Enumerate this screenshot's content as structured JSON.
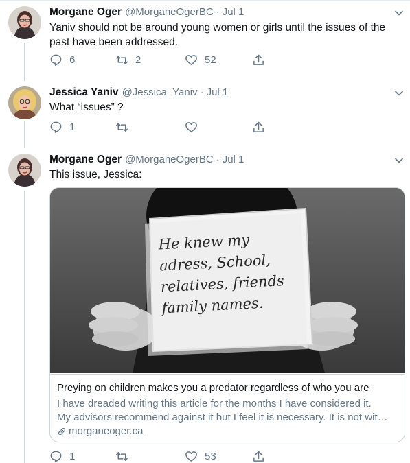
{
  "tweets": [
    {
      "name": "Morgane Oger",
      "handle": "@MorganeOgerBC",
      "separator": "·",
      "date": "Jul 1",
      "text_lines": [
        "Yaniv should not be around young women or girls until the issues of the",
        "past have been addressed."
      ],
      "reply_count": "6",
      "retweet_count": "2",
      "like_count": "52"
    },
    {
      "name": "Jessica Yaniv",
      "handle": "@Jessica_Yaniv",
      "separator": "·",
      "date": "Jul 1",
      "text_lines": [
        "What “issues” ?"
      ],
      "reply_count": "1",
      "retweet_count": "",
      "like_count": ""
    },
    {
      "name": "Morgane Oger",
      "handle": "@MorganeOgerBC",
      "separator": "·",
      "date": "Jul 1",
      "text_lines": [
        "This issue, Jessica:"
      ],
      "reply_count": "1",
      "retweet_count": "",
      "like_count": "53",
      "card": {
        "image_text": [
          "He knew my",
          "adress, School,",
          "relatives, friends",
          "family names."
        ],
        "title": "Preying on children makes you a predator regardless of who you are",
        "description_lines": [
          "I have dreaded writing this article for the months I have considered it.",
          "My advisors recommend against it but I feel it is necessary. It is not wit…"
        ],
        "domain": "morganeoger.ca"
      }
    }
  ],
  "icons": {
    "reply": "speech-bubble-icon",
    "retweet": "retweet-icon",
    "like": "heart-icon",
    "share": "share-icon",
    "more": "chevron-down-icon",
    "link": "link-icon"
  },
  "colors": {
    "text": "#14171a",
    "secondary": "#657786",
    "border": "#ccd6dd"
  }
}
